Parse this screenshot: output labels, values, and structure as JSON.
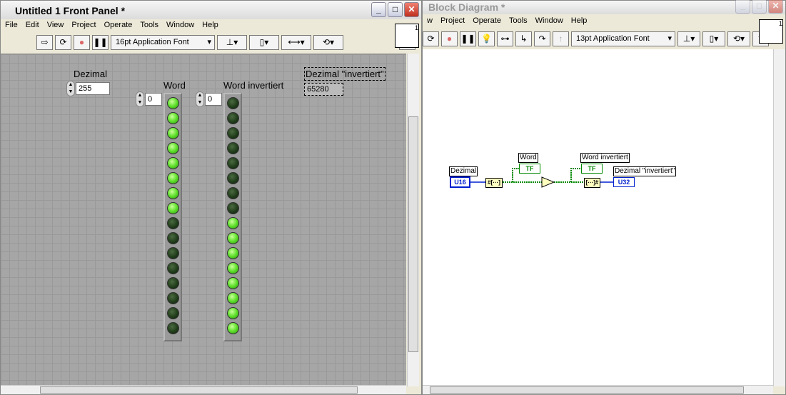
{
  "front_panel": {
    "title": "Untitled 1 Front Panel *",
    "menu": [
      "File",
      "Edit",
      "View",
      "Project",
      "Operate",
      "Tools",
      "Window",
      "Help"
    ],
    "font": "16pt Application Font",
    "controls": {
      "dezimal": {
        "label": "Dezimal",
        "value": "255"
      },
      "word": {
        "label": "Word",
        "index": "0",
        "leds": [
          1,
          1,
          1,
          1,
          1,
          1,
          1,
          1,
          0,
          0,
          0,
          0,
          0,
          0,
          0,
          0
        ]
      },
      "word_inv": {
        "label": "Word invertiert",
        "index": "0",
        "leds": [
          0,
          0,
          0,
          0,
          0,
          0,
          0,
          0,
          1,
          1,
          1,
          1,
          1,
          1,
          1,
          1
        ]
      },
      "dez_inv": {
        "label": "Dezimal \"invertiert\"",
        "value": "65280"
      }
    },
    "vi_icon_number": "1"
  },
  "block_diagram": {
    "title": "Block Diagram *",
    "menu": [
      "w",
      "Project",
      "Operate",
      "Tools",
      "Window",
      "Help"
    ],
    "font": "13pt Application Font",
    "nodes": {
      "dezimal": "Dezimal",
      "dezimal_type": "U16",
      "word": "Word",
      "word_type": "TF",
      "word_inv": "Word invertiert",
      "word_inv_type": "TF",
      "dez_inv": "Dezimal \"invertiert\"",
      "dez_inv_type": "U32",
      "n2b": "#[···]",
      "not": "¬",
      "b2n": "[···]#"
    },
    "vi_icon_number": "1"
  }
}
